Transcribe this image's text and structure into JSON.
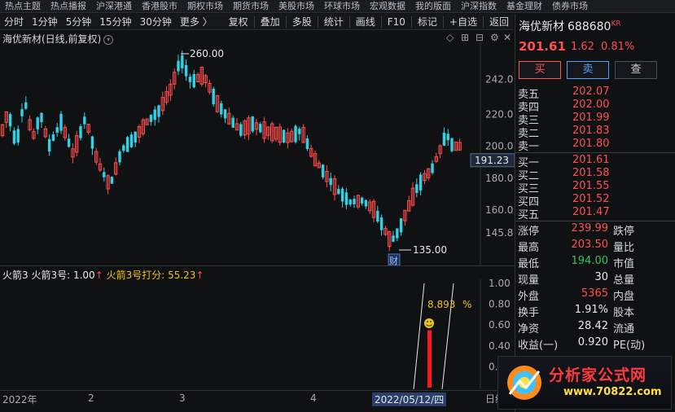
{
  "topnav": [
    "热点主题",
    "热点播报",
    "沪深港通",
    "香港股市",
    "期权市场",
    "期货市场",
    "美股市场",
    "环球市场",
    "宏观数据",
    "我的版面",
    "沪深指数",
    "基金理财",
    "债券市场"
  ],
  "toolbar": {
    "periods": [
      "分时",
      "1分钟",
      "5分钟",
      "15分钟",
      "30分钟",
      "更多 〉"
    ],
    "tools": [
      "复权",
      "叠加",
      "多股",
      "统计",
      "画线",
      "F10",
      "标记",
      "+自选",
      "返回"
    ]
  },
  "chart": {
    "title": "海优新材(日线,前复权)",
    "y_ticks": [
      "242.0",
      "220.0",
      "200.0",
      "180.0",
      "160.0",
      "145.8"
    ],
    "current_price_label": "191.23",
    "high_mark": "260.00",
    "low_mark": "135.00",
    "event_tag": "财"
  },
  "chart_data": {
    "type": "candlestick",
    "y_range": [
      135,
      260
    ],
    "high": 260.0,
    "low": 135.0,
    "current": 191.23
  },
  "indicator": {
    "name": "火箭3",
    "line1": "火箭3号: 1.00",
    "line2": "火箭3号打分: 55.23",
    "y_ticks": [
      "1.00",
      "0.80",
      "0.60",
      "0.40",
      "0.20"
    ],
    "score": "8.893",
    "pct": "%"
  },
  "xaxis": {
    "labels": [
      "2022年",
      "2",
      "3",
      "4"
    ],
    "cursor_date": "2022/05/12/四",
    "right_label": "日线"
  },
  "quote": {
    "name": "海优新材",
    "code": "688680",
    "market": "KR",
    "price": "201.61",
    "change": "1.62",
    "pct": "0.81%",
    "buy": "买",
    "sell": "卖",
    "check": "查",
    "asks": [
      {
        "label": "卖五",
        "value": "202.07"
      },
      {
        "label": "卖四",
        "value": "202.00"
      },
      {
        "label": "卖三",
        "value": "201.99"
      },
      {
        "label": "卖二",
        "value": "201.83"
      },
      {
        "label": "卖一",
        "value": "201.80"
      }
    ],
    "bids": [
      {
        "label": "买一",
        "value": "201.61"
      },
      {
        "label": "买二",
        "value": "201.58"
      },
      {
        "label": "买三",
        "value": "201.55"
      },
      {
        "label": "买四",
        "value": "201.52"
      },
      {
        "label": "买五",
        "value": "201.47"
      }
    ],
    "stats": [
      {
        "l1": "涨停",
        "v1": "239.99",
        "c": "red",
        "l2": "跌停"
      },
      {
        "l1": "最高",
        "v1": "203.50",
        "c": "red",
        "l2": "量比"
      },
      {
        "l1": "最低",
        "v1": "194.00",
        "c": "green",
        "l2": "市值"
      },
      {
        "l1": "现量",
        "v1": "30",
        "c": "white",
        "l2": "总量"
      },
      {
        "l1": "外盘",
        "v1": "5365",
        "c": "red",
        "l2": "内盘"
      },
      {
        "l1": "换手",
        "v1": "1.91%",
        "c": "white",
        "l2": "股本"
      },
      {
        "l1": "净资",
        "v1": "28.42",
        "c": "white",
        "l2": "流通"
      },
      {
        "l1": "收益(一)",
        "v1": "0.920",
        "c": "white",
        "l2": "PE(动)"
      }
    ]
  },
  "logo": {
    "line1": "分析家公式网",
    "line2": "www.70822.com"
  }
}
